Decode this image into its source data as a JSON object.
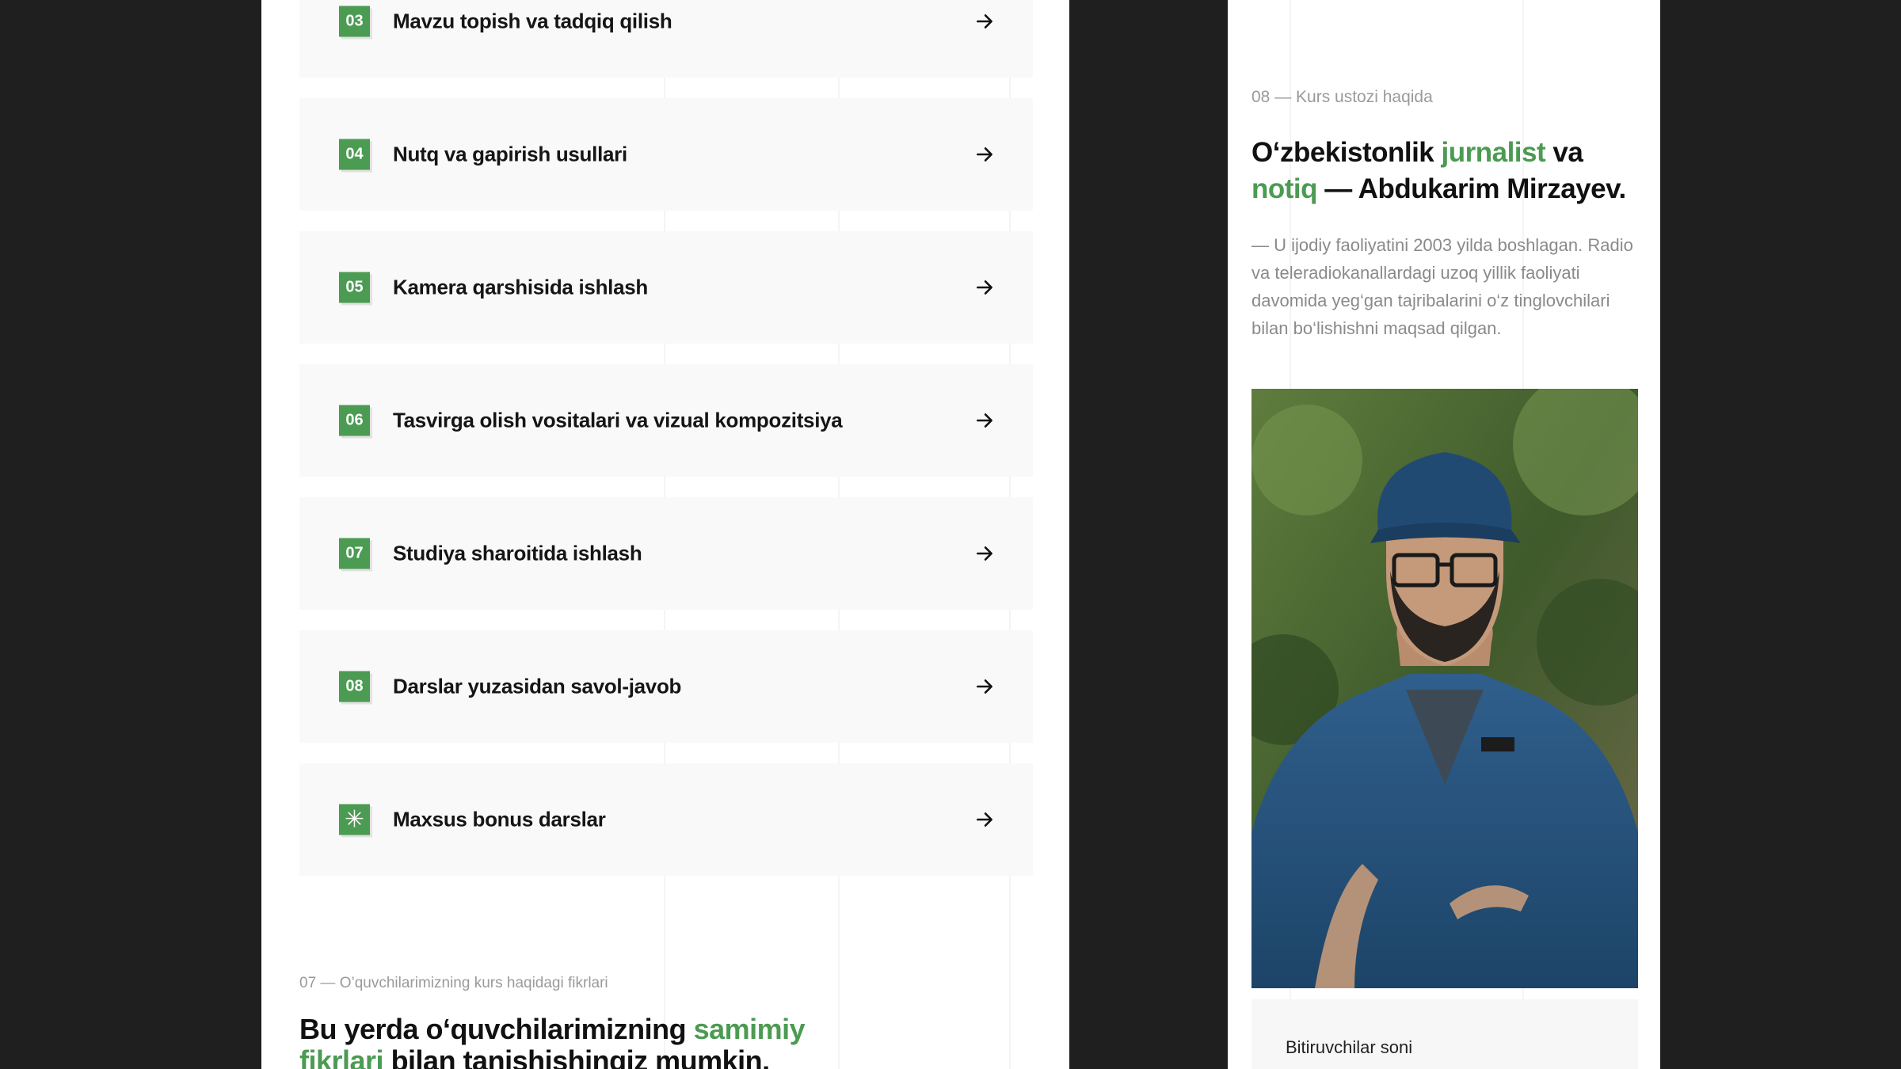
{
  "lessons": [
    {
      "num": "03",
      "title": "Mavzu topish va tadqiq qilish"
    },
    {
      "num": "04",
      "title": "Nutq va gapirish usullari"
    },
    {
      "num": "05",
      "title": "Kamera qarshisida ishlash"
    },
    {
      "num": "06",
      "title": "Tasvirga olish vositalari va vizual kompozitsiya"
    },
    {
      "num": "07",
      "title": "Studiya sharoitida ishlash"
    },
    {
      "num": "08",
      "title": "Darslar yuzasidan savol-javob"
    },
    {
      "num": "✳",
      "title": "Maxsus bonus darslar"
    }
  ],
  "reviews": {
    "label": "07 — O’quvchilarimizning kurs haqidagi fikrlari",
    "heading_part1": "Bu yerda o‘quvchilarimizning ",
    "heading_highlight": "samimiy fikrlari",
    "heading_part2": " bilan tanishishingiz mumkin."
  },
  "teacher": {
    "label": "08 — Kurs ustozi haqida",
    "heading_part1": "O‘zbekistonlik ",
    "heading_highlight1": "jurnalist",
    "heading_part2": " va ",
    "heading_highlight2": "notiq",
    "heading_part3": " — Abdukarim Mirzayev.",
    "bio": "— U ijodiy faoliyatini 2003 yilda boshlagan. Radio va teleradiokanallardagi uzoq yillik faoliyati davomida yeg‘gan tajribalarini o‘z tinglovchilari bilan bo‘lishishni maqsad qilgan.",
    "stats_label": "Bitiruvchilar soni"
  },
  "colors": {
    "accent": "#4b9b52",
    "backdrop": "#1f1f1f"
  },
  "icons": {
    "arrow": "arrow-right-icon"
  }
}
